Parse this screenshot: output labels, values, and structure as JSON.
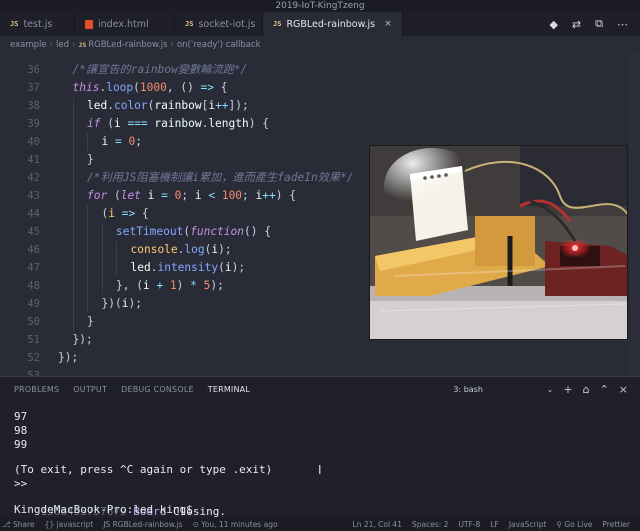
{
  "window": {
    "title": "2019-IoT-KingTzeng"
  },
  "tabs": [
    {
      "label": "test.js",
      "badge": "JS",
      "type": "js"
    },
    {
      "label": "index.html",
      "type": "html"
    },
    {
      "label": "socket-iot.js",
      "badge": "JS",
      "type": "js"
    },
    {
      "label": "RGBLed-rainbow.js",
      "badge": "JS",
      "type": "js",
      "active": true
    }
  ],
  "tab_close_glyph": "×",
  "tab_actions": [
    "◆",
    "⇄",
    "⧉",
    "⋯"
  ],
  "breadcrumb": {
    "parts": [
      "example",
      "led",
      "RGBLed-rainbow.js",
      "on('ready') callback"
    ],
    "file_badge": "JS",
    "separator": "›"
  },
  "editor": {
    "line_numbers": [
      "36",
      "37",
      "38",
      "39",
      "40",
      "41",
      "42",
      "43",
      "44",
      "45",
      "46",
      "47",
      "48",
      "49",
      "50",
      "51",
      "52",
      "53"
    ],
    "code": [
      [
        [
          "cmt",
          "/*讓宣告的rainbow變數輪流跑*/"
        ]
      ],
      [
        [
          "kw",
          "this"
        ],
        [
          "pu",
          "."
        ],
        [
          "fn",
          "loop"
        ],
        [
          "pu",
          "("
        ],
        [
          "num",
          "1000"
        ],
        [
          "pu",
          ", () "
        ],
        [
          "op",
          "=>"
        ],
        [
          "pu",
          " {"
        ]
      ],
      [
        [
          "pl",
          "led"
        ],
        [
          "pu",
          "."
        ],
        [
          "fn",
          "color"
        ],
        [
          "pu",
          "("
        ],
        [
          "pl",
          "rainbow"
        ],
        [
          "pu",
          "["
        ],
        [
          "pl",
          "i"
        ],
        [
          "op",
          "++"
        ],
        [
          "pu",
          "]);"
        ]
      ],
      [
        [
          "kw",
          "if"
        ],
        [
          "pu",
          " ("
        ],
        [
          "pl",
          "i "
        ],
        [
          "op",
          "==="
        ],
        [
          "pl",
          " rainbow"
        ],
        [
          "pu",
          "."
        ],
        [
          "pl",
          "length"
        ],
        [
          "pu",
          ") {"
        ]
      ],
      [
        [
          "pl",
          "i "
        ],
        [
          "op",
          "="
        ],
        [
          "pu",
          " "
        ],
        [
          "num",
          "0"
        ],
        [
          "pu",
          ";"
        ]
      ],
      [
        [
          "pu",
          "}"
        ]
      ],
      [
        [
          "cmt",
          "/*利用JS阻塞機制讓i累加，進而產生fadeIn效果*/"
        ]
      ],
      [
        [
          "kw",
          "for"
        ],
        [
          "pu",
          " ("
        ],
        [
          "kw",
          "let"
        ],
        [
          "pl",
          " i "
        ],
        [
          "op",
          "="
        ],
        [
          "num",
          " 0"
        ],
        [
          "pu",
          "; "
        ],
        [
          "pl",
          "i "
        ],
        [
          "op",
          "<"
        ],
        [
          "num",
          " 100"
        ],
        [
          "pu",
          "; "
        ],
        [
          "pl",
          "i"
        ],
        [
          "op",
          "++"
        ],
        [
          "pu",
          ") {"
        ]
      ],
      [
        [
          "pu",
          "("
        ],
        [
          "pr",
          "i"
        ],
        [
          "op",
          " =>"
        ],
        [
          "pu",
          " {"
        ]
      ],
      [
        [
          "fn",
          "setTimeout"
        ],
        [
          "pu",
          "("
        ],
        [
          "kw",
          "function"
        ],
        [
          "pu",
          "() {"
        ]
      ],
      [
        [
          "pr",
          "console"
        ],
        [
          "pu",
          "."
        ],
        [
          "fn",
          "log"
        ],
        [
          "pu",
          "("
        ],
        [
          "pl",
          "i"
        ],
        [
          "pu",
          ");"
        ]
      ],
      [
        [
          "pl",
          "led"
        ],
        [
          "pu",
          "."
        ],
        [
          "fn",
          "intensity"
        ],
        [
          "pu",
          "("
        ],
        [
          "pl",
          "i"
        ],
        [
          "pu",
          ");"
        ]
      ],
      [
        [
          "pu",
          "}, ("
        ],
        [
          "pl",
          "i "
        ],
        [
          "op",
          "+"
        ],
        [
          "num",
          " 1"
        ],
        [
          "pu",
          ") "
        ],
        [
          "op",
          "*"
        ],
        [
          "num",
          " 5"
        ],
        [
          "pu",
          ");"
        ]
      ],
      [
        [
          "pu",
          "})("
        ],
        [
          "pl",
          "i"
        ],
        [
          "pu",
          ");"
        ]
      ],
      [
        [
          "pu",
          "}"
        ]
      ],
      [
        [
          "pu",
          "});"
        ]
      ],
      [
        [
          "pu",
          "});"
        ]
      ],
      []
    ],
    "indents": [
      1,
      1,
      2,
      2,
      3,
      2,
      2,
      2,
      3,
      4,
      5,
      5,
      4,
      3,
      2,
      1,
      0,
      0
    ]
  },
  "panel": {
    "tabs": [
      "PROBLEMS",
      "OUTPUT",
      "DEBUG CONSOLE",
      "TERMINAL"
    ],
    "active_tab": "TERMINAL",
    "terminal_select": "3: bash",
    "select_chevron": "⌄",
    "actions": [
      "+",
      "⌂",
      "⌃",
      "×"
    ]
  },
  "terminal": {
    "lines": [
      "97",
      "98",
      "99",
      "",
      "(To exit, press ^C again or type .exit)",
      ">>"
    ],
    "timestamp": "1568453757679",
    "board_label": "Board",
    "closing_text": "Closing.",
    "prompt": "KingdeMacBook-Pro:led king$"
  },
  "status": {
    "left": [
      "⎇ Share",
      "{} javascript",
      "JS RGBLed-rainbow.js",
      "⊙ You, 11 minutes ago"
    ],
    "right": [
      "Ln 21, Col 41",
      "Spaces: 2",
      "UTF-8",
      "LF",
      "JavaScript",
      "⚲ Go Live",
      "Prettier"
    ]
  }
}
